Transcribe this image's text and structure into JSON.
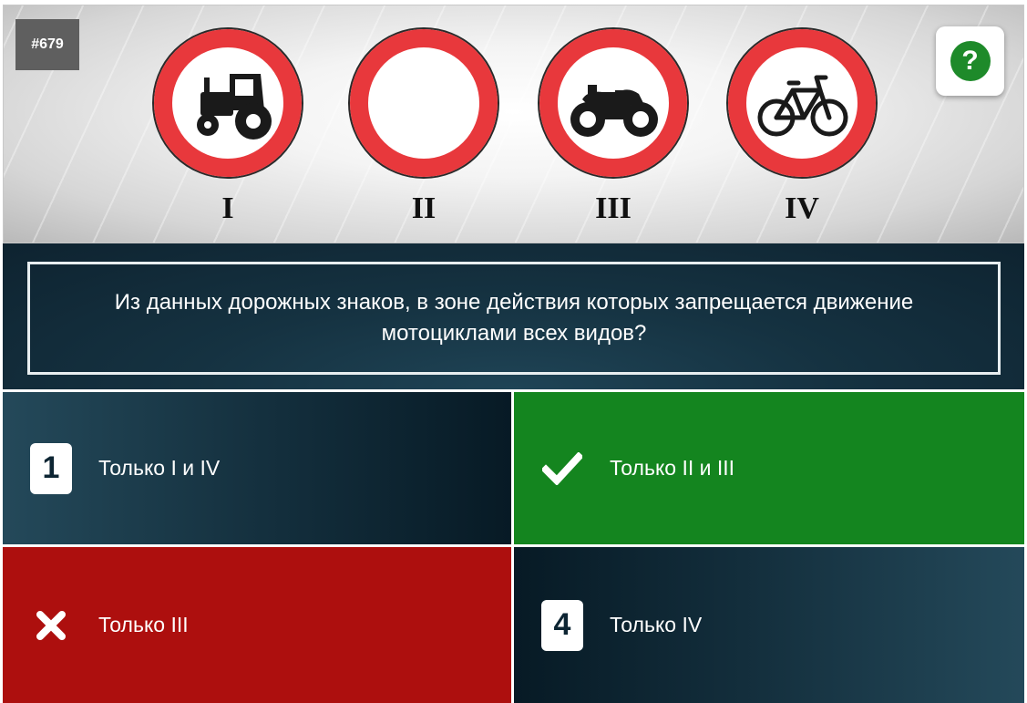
{
  "question": {
    "id": "#679",
    "text": "Из данных дорожных знаков, в зоне действия которых запрещается движение мотоциклами всех видов?"
  },
  "signs": [
    {
      "label": "I",
      "icon": "tractor-icon"
    },
    {
      "label": "II",
      "icon": "empty-icon"
    },
    {
      "label": "III",
      "icon": "motorcycle-icon"
    },
    {
      "label": "IV",
      "icon": "bicycle-icon"
    }
  ],
  "help": {
    "icon": "question-mark-icon",
    "symbol": "?"
  },
  "answers": [
    {
      "marker": "1",
      "text": "Только I и IV",
      "state": "neutral"
    },
    {
      "marker": "check-icon",
      "text": "Только II и III",
      "state": "correct"
    },
    {
      "marker": "cross-icon",
      "text": "Только III",
      "state": "wrong"
    },
    {
      "marker": "4",
      "text": "Только IV",
      "state": "neutral"
    }
  ],
  "colors": {
    "sign_red": "#e8383c",
    "correct": "#14851f",
    "wrong": "#ad0f0e",
    "dark_panel": "#132e3c",
    "help_green": "#1e8a2a"
  }
}
